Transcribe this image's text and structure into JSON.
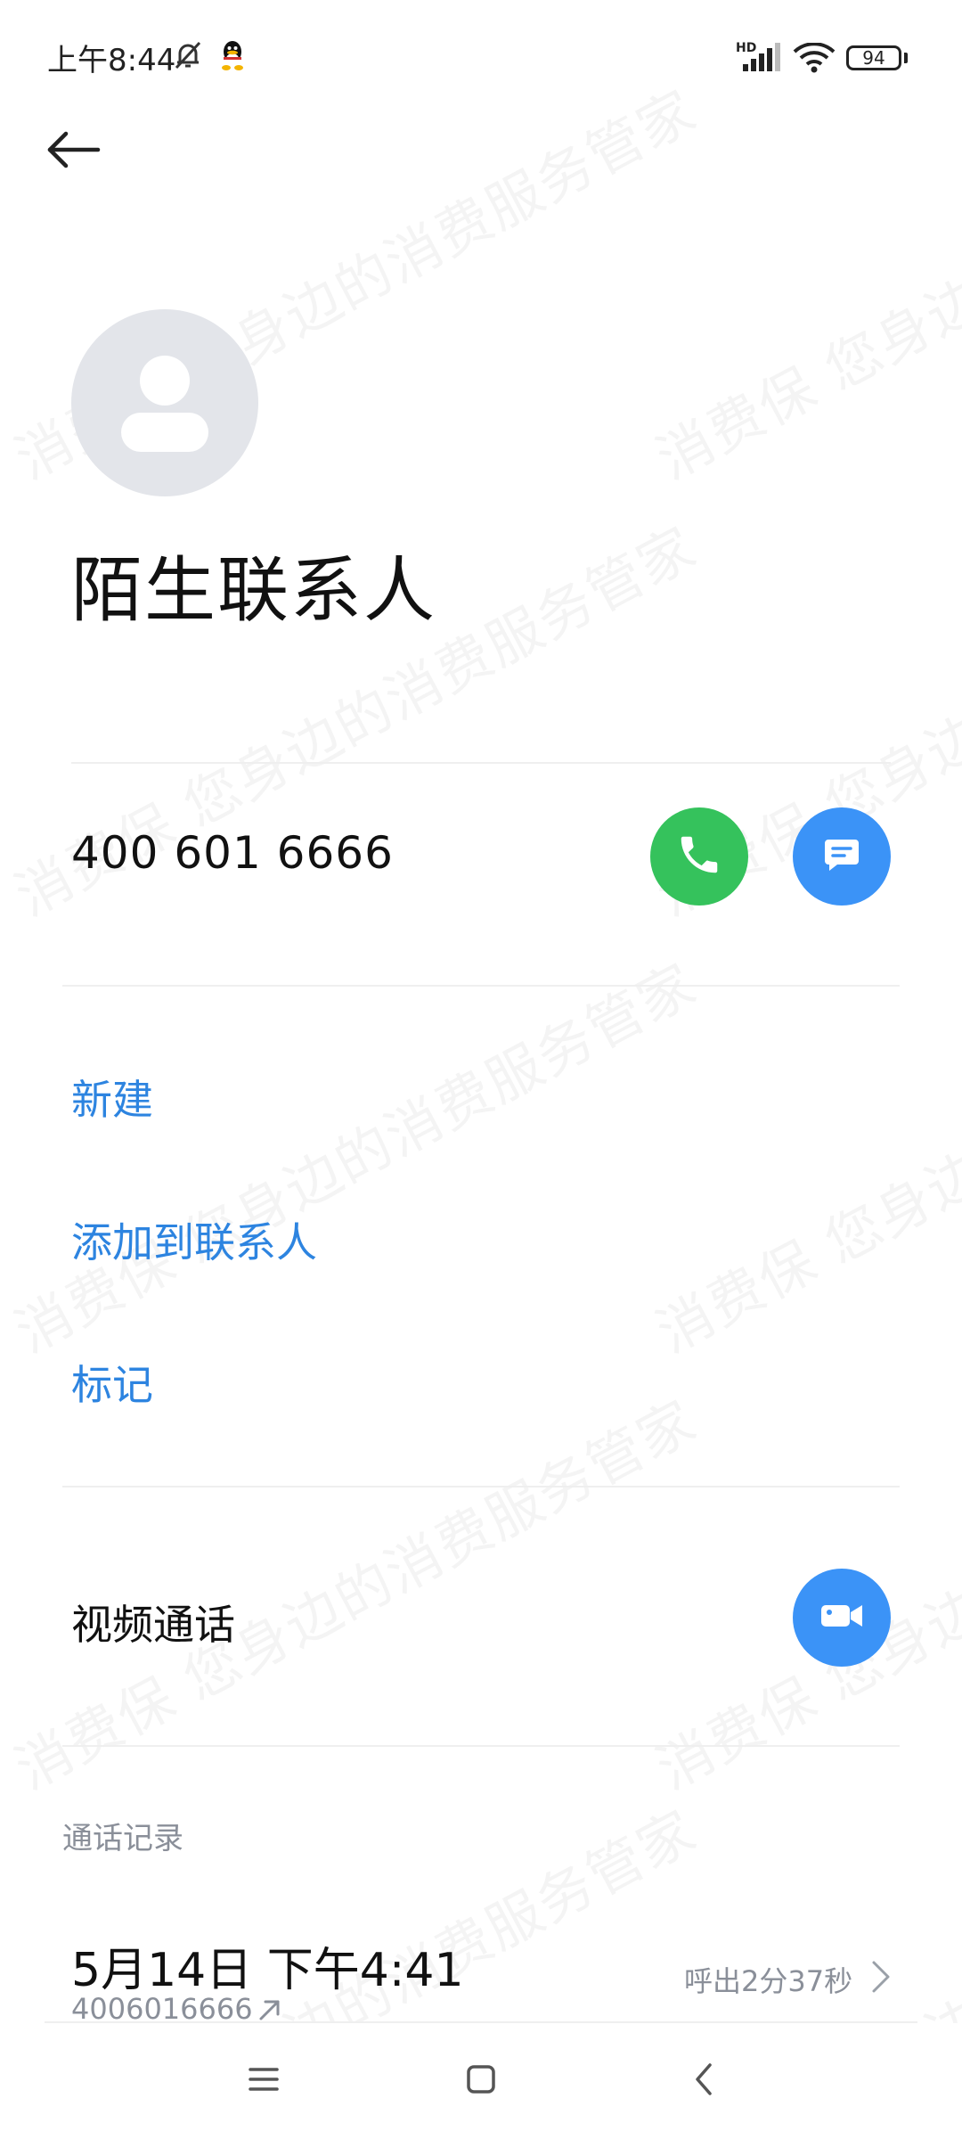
{
  "status_bar": {
    "time": "上午8:44",
    "network_label": "HD",
    "battery_level": "94"
  },
  "contact": {
    "name": "陌生联系人",
    "phone": "400 601 6666"
  },
  "actions": {
    "new": "新建",
    "add_to_contacts": "添加到联系人",
    "mark": "标记"
  },
  "video_call": {
    "label": "视频通话"
  },
  "call_log": {
    "title": "通话记录",
    "items": [
      {
        "datetime": "5月14日 下午4:41",
        "number": "4006016666",
        "detail": "呼出2分37秒",
        "direction_icon": "outgoing-arrow-icon"
      }
    ]
  },
  "watermark": {
    "text": "消费保 您身边的消费服务管家"
  },
  "colors": {
    "call_green": "#35c25c",
    "accent_blue": "#3b93f7",
    "link_blue": "#2d84e0",
    "secondary_gray": "#8a8f99",
    "avatar_gray": "#e3e5ea"
  },
  "icons": {
    "back": "back-arrow-icon",
    "call": "phone-icon",
    "message": "message-icon",
    "video": "video-camera-icon",
    "nav_menu": "menu-icon",
    "nav_home": "home-icon",
    "nav_back": "chevron-left-icon"
  }
}
